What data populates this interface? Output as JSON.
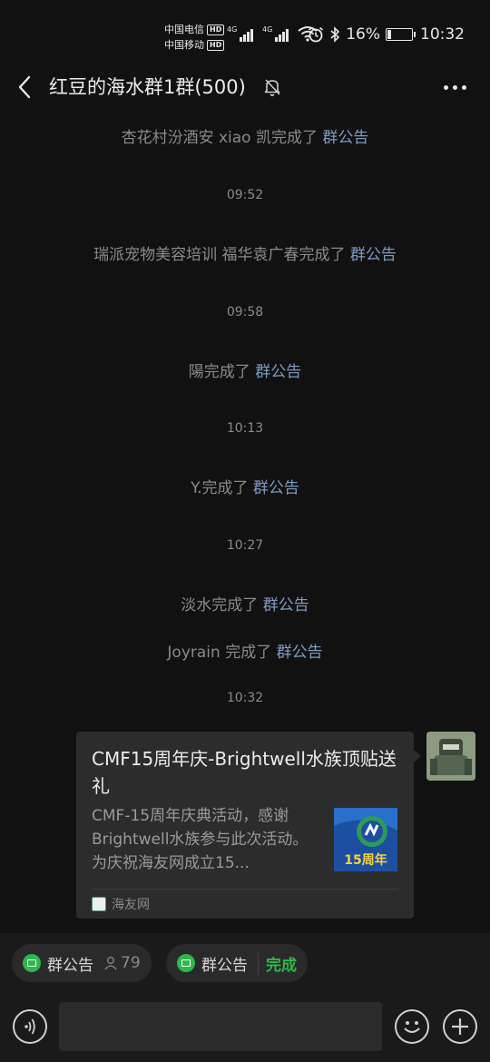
{
  "status_bar": {
    "carrier1": "中国电信",
    "carrier2": "中国移动",
    "hd": "HD",
    "network": "4G",
    "battery_percent": "16%",
    "battery_level": 0.16,
    "time": "10:32"
  },
  "header": {
    "title": "红豆的海水群1群(500)"
  },
  "messages": [
    {
      "type": "system",
      "text": "杏花村汾酒安 xiao 凯完成了 ",
      "link": "群公告"
    },
    {
      "type": "time",
      "text": "09:52"
    },
    {
      "type": "system",
      "text": "瑞派宠物美容培训 福华袁广春完成了 ",
      "link": "群公告"
    },
    {
      "type": "time",
      "text": "09:58"
    },
    {
      "type": "system",
      "text": "陽完成了 ",
      "link": "群公告"
    },
    {
      "type": "time",
      "text": "10:13"
    },
    {
      "type": "system",
      "text": "Y.完成了 ",
      "link": "群公告"
    },
    {
      "type": "time",
      "text": "10:27"
    },
    {
      "type": "system",
      "text": "淡水完成了 ",
      "link": "群公告"
    },
    {
      "type": "system",
      "text": "Joyrain 完成了 ",
      "link": "群公告"
    },
    {
      "type": "time",
      "text": "10:32"
    }
  ],
  "card": {
    "title": "CMF15周年庆-Brightwell水族顶贴送礼",
    "description": "CMF-15周年庆典活动，感谢Brightwell水族参与此次活动。为庆祝海友网成立15...",
    "thumb_text": "15周年",
    "source": "海友网"
  },
  "quick_bar": {
    "chip1_label": "群公告",
    "chip1_count": "79",
    "chip2_label": "群公告",
    "chip2_status": "完成"
  },
  "input": {
    "placeholder": ""
  },
  "colors": {
    "background": "#111111",
    "link": "#7e9bc2",
    "accent_green": "#2db84c"
  }
}
